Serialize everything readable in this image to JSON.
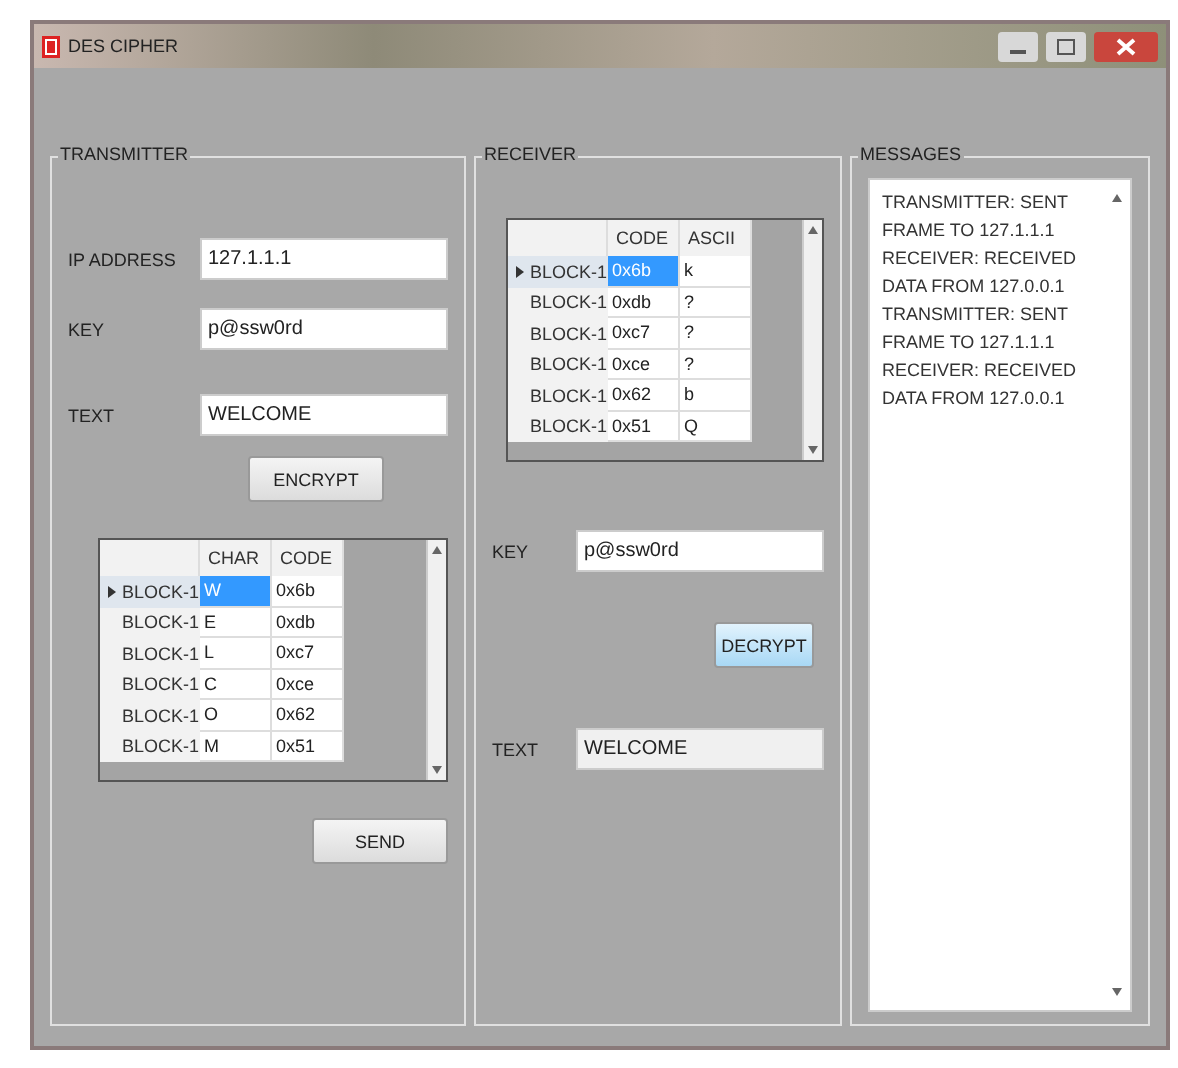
{
  "window": {
    "title": "DES CIPHER"
  },
  "transmitter": {
    "title": "TRANSMITTER",
    "fields": [
      {
        "label": "IP ADDRESS",
        "value": "127.1.1.1"
      },
      {
        "label": "KEY",
        "value": "p@ssw0rd"
      },
      {
        "label": "TEXT",
        "value": "WELCOME"
      }
    ],
    "encrypt_button": "ENCRYPT",
    "table": {
      "columns": [
        "CHAR",
        "CODE"
      ],
      "rows": [
        {
          "header": "BLOCK-1",
          "cells": [
            "W",
            "0x6b"
          ],
          "selected": true
        },
        {
          "header": "BLOCK-1",
          "cells": [
            "E",
            "0xdb"
          ],
          "selected": false
        },
        {
          "header": "BLOCK-1",
          "cells": [
            "L",
            "0xc7"
          ],
          "selected": false
        },
        {
          "header": "BLOCK-1",
          "cells": [
            "C",
            "0xce"
          ],
          "selected": false
        },
        {
          "header": "BLOCK-1",
          "cells": [
            "O",
            "0x62"
          ],
          "selected": false
        },
        {
          "header": "BLOCK-1",
          "cells": [
            "M",
            "0x51"
          ],
          "selected": false
        }
      ]
    },
    "send_button": "SEND"
  },
  "receiver": {
    "title": "RECEIVER",
    "table": {
      "columns": [
        "CODE",
        "ASCII"
      ],
      "rows": [
        {
          "header": "BLOCK-1",
          "cells": [
            "0x6b",
            "k"
          ],
          "selected": true
        },
        {
          "header": "BLOCK-1",
          "cells": [
            "0xdb",
            "?"
          ],
          "selected": false
        },
        {
          "header": "BLOCK-1",
          "cells": [
            "0xc7",
            "?"
          ],
          "selected": false
        },
        {
          "header": "BLOCK-1",
          "cells": [
            "0xce",
            "?"
          ],
          "selected": false
        },
        {
          "header": "BLOCK-1",
          "cells": [
            "0x62",
            "b"
          ],
          "selected": false
        },
        {
          "header": "BLOCK-1",
          "cells": [
            "0x51",
            "Q"
          ],
          "selected": false
        }
      ]
    },
    "key": {
      "label": "KEY",
      "value": "p@ssw0rd"
    },
    "decrypt_button": "DECRYPT",
    "text": {
      "label": "TEXT",
      "value": "WELCOME"
    }
  },
  "messages": {
    "title": "MESSAGES",
    "items": [
      "TRANSMITTER: SENT FRAME TO 127.1.1.1",
      "RECEIVER: RECEIVED DATA FROM 127.0.0.1",
      "TRANSMITTER: SENT FRAME TO 127.1.1.1",
      "RECEIVER: RECEIVED DATA FROM 127.0.0.1"
    ]
  }
}
